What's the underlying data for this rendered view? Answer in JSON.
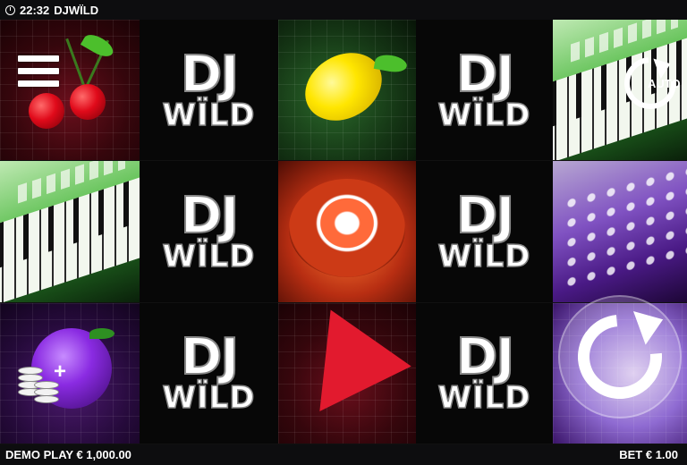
{
  "status_bar": {
    "time": "22:32",
    "game_title": "DJWÏLD"
  },
  "reels": [
    {
      "symbols": [
        "cherries",
        "keyboard",
        "plum"
      ]
    },
    {
      "symbols": [
        "dj-wild",
        "dj-wild",
        "dj-wild"
      ]
    },
    {
      "symbols": [
        "lemon",
        "turntable",
        "watermelon"
      ]
    },
    {
      "symbols": [
        "dj-wild",
        "dj-wild",
        "dj-wild"
      ]
    },
    {
      "symbols": [
        "keyboard",
        "mixer",
        "deck"
      ]
    }
  ],
  "wild_symbol": {
    "line1": "DJ",
    "line2": "WÏLD"
  },
  "controls": {
    "menu_icon": "hamburger-icon",
    "auto_label": "AUTO",
    "spin_icon": "spin-arrow-icon",
    "bet_icon": "coins-plus-icon"
  },
  "footer": {
    "balance_text": "DEMO PLAY € 1,000.00",
    "bet_text": "BET € 1.00"
  }
}
